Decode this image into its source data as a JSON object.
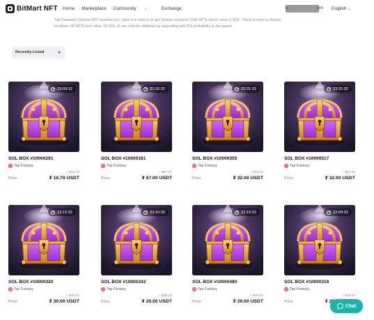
{
  "header": {
    "brand": "BitMart",
    "brand_suffix": "NFT",
    "nav": [
      {
        "label": "Home",
        "has_dropdown": false
      },
      {
        "label": "Marketplace",
        "has_dropdown": false
      },
      {
        "label": "Community",
        "has_dropdown": true
      },
      {
        "label": "Exchange",
        "has_dropdown": false
      }
    ],
    "account_left": "c",
    "account_right": "om",
    "language": "English"
  },
  "description": {
    "line1": "Tap Fantasy's Solana NFT mystery box, open it a chance to get Solana exclusive SSR NFTs which value 5 SOL. There is even a chance",
    "line2": "to obtain SP NFTs that value 30 SOL. It can only be obtained by upgrading with 5% probability in the game!"
  },
  "sort": {
    "selected": "Recently Listed"
  },
  "price_label": "Price",
  "currency": "USDT",
  "cards": [
    {
      "title": "SOL BOX #10000291",
      "collection": "Tap Fantasy",
      "timer": "23:09:32",
      "usd": "≈ $16.79",
      "price": "16.78 USDT"
    },
    {
      "title": "SOL BOX #10000181",
      "collection": "Tap Fantasy",
      "timer": "22:32:32",
      "usd": "≈ $67.07",
      "price": "67.00 USDT"
    },
    {
      "title": "SOL BOX #10000355",
      "collection": "Tap Fantasy",
      "timer": "22:31:32",
      "usd": "≈ $32.03",
      "price": "32.00 USDT"
    },
    {
      "title": "SOL BOX #10000517",
      "collection": "Tap Fantasy",
      "timer": "22:31:32",
      "usd": "≈ $32.03",
      "price": "32.00 USDT"
    },
    {
      "title": "SOL BOX #10000320",
      "collection": "Tap Fantasy",
      "timer": "22:15:32",
      "usd": "≈ $30.03",
      "price": "30.00 USDT"
    },
    {
      "title": "SOL BOX #10000342",
      "collection": "Tap Fantasy",
      "timer": "22:10:32",
      "usd": "≈ $29.03",
      "price": "29.00 USDT"
    },
    {
      "title": "SOL BOX #10000480",
      "collection": "Tap Fantasy",
      "timer": "22:10:32",
      "usd": "≈ $29.03",
      "price": "29.00 USDT"
    },
    {
      "title": "SOL BOX #10000316",
      "collection": "Tap Fantasy",
      "timer": "22:09:32",
      "usd": "≈ $29.03",
      "price": "29.00 USDT"
    }
  ],
  "chat": {
    "label": "Chat",
    "icon": "chat-bubble-icon"
  },
  "colors": {
    "chat": "#19b3aa",
    "chest_purple": "#b43fe0",
    "chest_gold": "#e3a43a"
  }
}
